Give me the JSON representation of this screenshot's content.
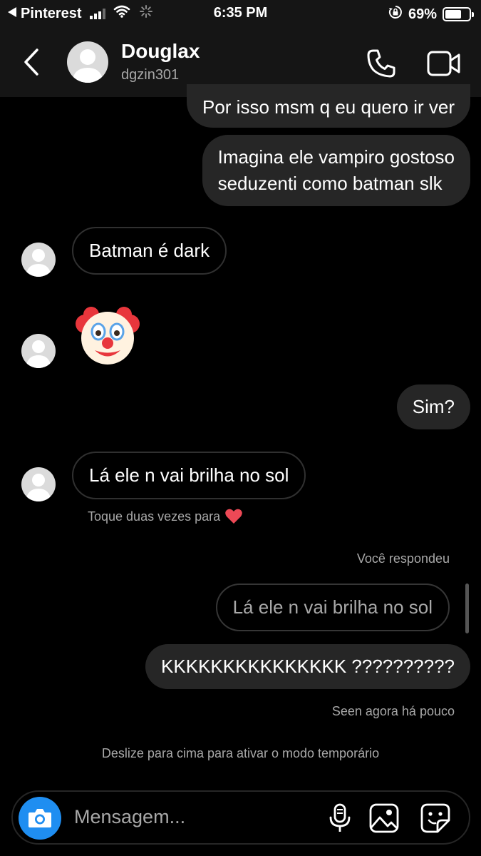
{
  "status_bar": {
    "back_app": "Pinterest",
    "time": "6:35 PM",
    "battery_percent": "69%",
    "battery_level": 0.69
  },
  "header": {
    "name": "Douglax",
    "username": "dgzin301"
  },
  "messages": [
    {
      "type": "sent",
      "text": "Por isso msm q eu quero ir ver"
    },
    {
      "type": "sent",
      "lines": [
        "Imagina ele vampiro gostoso",
        "seduzenti como batman slk"
      ]
    },
    {
      "type": "received",
      "text": "Batman é dark"
    },
    {
      "type": "received",
      "emoji": "clown-face"
    },
    {
      "type": "sent",
      "text": "Sim?"
    },
    {
      "type": "received",
      "text": "Lá ele n vai brilha no sol",
      "hint": "Toque duas vezes para"
    },
    {
      "type": "reply",
      "label": "Você respondeu",
      "quoted": "Lá ele n vai brilha no sol"
    },
    {
      "type": "sent",
      "text": "KKKKKKKKKKKKKKK ??????????"
    }
  ],
  "seen_status": "Seen agora há pouco",
  "temporary_mode_hint": "Deslize para cima para ativar o modo temporário",
  "composer": {
    "placeholder": "Mensagem..."
  },
  "colors": {
    "background": "#000000",
    "header": "#151515",
    "sent_bubble": "#262626",
    "camera_button": "#1f8ef1",
    "heart": "#ed4956"
  }
}
